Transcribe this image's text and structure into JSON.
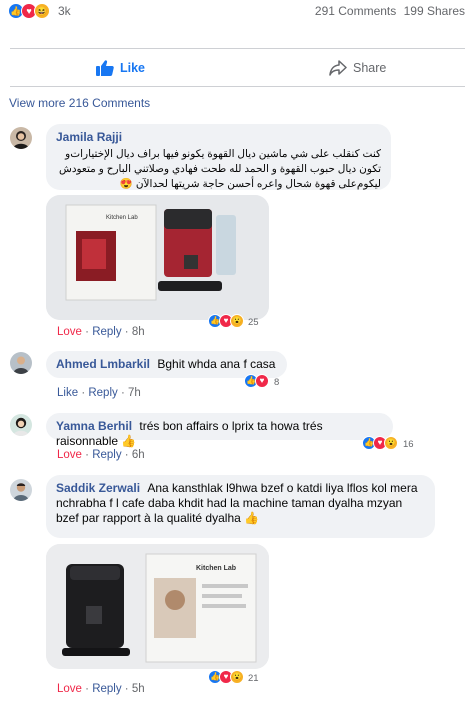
{
  "post_stats": {
    "reaction_count": "3k",
    "comments": "291 Comments",
    "shares": "199 Shares"
  },
  "actions": {
    "like_label": "Like",
    "share_label": "Share"
  },
  "view_more": "View more 216 Comments",
  "comments": [
    {
      "author": "Jamila Rajji",
      "text": "كنت كنقلب على شي ماشين ديال القهوة يكونو فيها براف ديال الإختيارات‌و تكون ديال حبوب القهوة و الحمد لله طحت فهادي وصلاتني البارح و متعودش ليكوم‌على قهوة شحال واعره أحسن حاجة شريتها لحدالآن 😍",
      "love_label": "Love",
      "reply_label": "Reply",
      "time": "8h",
      "reaction_count": "25"
    },
    {
      "author": "Ahmed Lmbarkil",
      "text": "Bghit whda ana f casa",
      "like_label": "Like",
      "reply_label": "Reply",
      "time": "7h",
      "reaction_count": "8"
    },
    {
      "author": "Yamna Berhil",
      "text": "trés bon affairs o lprix ta howa trés raisonnable 👍",
      "love_label": "Love",
      "reply_label": "Reply",
      "time": "6h",
      "reaction_count": "16"
    },
    {
      "author": "Saddik Zerwali",
      "text": "Ana kansthlak l9hwa bzef o katdi liya lflos kol mera nchrabha f l cafe daba khdit had la machine taman dyalha mzyan bzef par rapport à la qualité dyalha 👍",
      "love_label": "Love",
      "reply_label": "Reply",
      "time": "5h",
      "reaction_count": "21"
    }
  ],
  "photo_text": {
    "brand": "Kitchen Lab"
  },
  "colors": {
    "link_blue": "#385898",
    "fb_blue": "#1877f2",
    "love_red": "#f02849",
    "bubble_gray": "#f0f2f5",
    "meta_gray": "#65676b"
  }
}
